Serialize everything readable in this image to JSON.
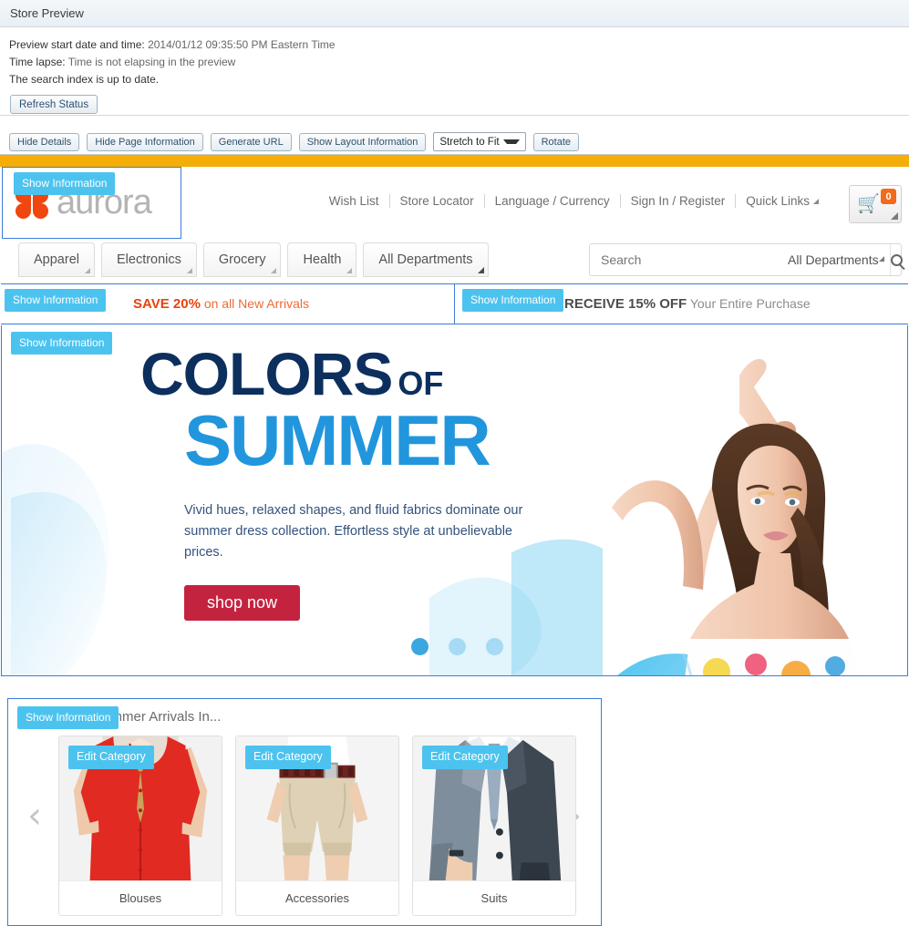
{
  "preview": {
    "title": "Store Preview",
    "start_label": "Preview start date and time:",
    "start_value": "2014/01/12 09:35:50 PM Eastern Time",
    "lapse_label": "Time lapse:",
    "lapse_value": "Time is not elapsing in the preview",
    "index_status": "The search index is up to date.",
    "refresh_button": "Refresh Status",
    "toolbar": {
      "hide_details": "Hide Details",
      "hide_page_information": "Hide Page Information",
      "generate_url": "Generate URL",
      "show_layout_information": "Show Layout Information",
      "fit_select": "Stretch to Fit",
      "rotate": "Rotate"
    }
  },
  "store": {
    "logo_text": "aurora",
    "top_links": [
      "Wish List",
      "Store Locator",
      "Language / Currency",
      "Sign In / Register",
      "Quick Links"
    ],
    "cart_count": "0",
    "departments": [
      "Apparel",
      "Electronics",
      "Grocery",
      "Health",
      "All Departments"
    ],
    "search": {
      "placeholder": "Search",
      "scope": "All Departments"
    },
    "promos": [
      {
        "strong": "SAVE 20%",
        "rest": " on all New Arrivals"
      },
      {
        "strong": "RECEIVE 15% OFF",
        "rest": " Your Entire Purchase"
      }
    ],
    "hero": {
      "line1": "COLORS",
      "line1_small": "OF",
      "line2": "SUMMER",
      "description": "Vivid hues, relaxed shapes, and fluid fabrics dominate our summer dress collection. Effortless style at unbelievable prices.",
      "cta": "shop now",
      "slide_count": 3,
      "active_slide": 1
    },
    "categories": {
      "title": "New Summer Arrivals In...",
      "edit_badge": "Edit Category",
      "items": [
        {
          "label": "Blouses"
        },
        {
          "label": "Accessories"
        },
        {
          "label": "Suits"
        }
      ],
      "prev_arrow": "‹",
      "next_arrow": "›"
    },
    "show_information_badge": "Show Information"
  },
  "colors": {
    "accent_orange": "#f5ad07",
    "logo_orange": "#f0460f",
    "badge_blue": "#4cc3ef",
    "hero_navy": "#0c2f5e",
    "hero_blue": "#2196dd",
    "cta_red": "#c42340",
    "cart_badge_orange": "#f26a1b",
    "frame_blue": "#3b7dd8"
  }
}
